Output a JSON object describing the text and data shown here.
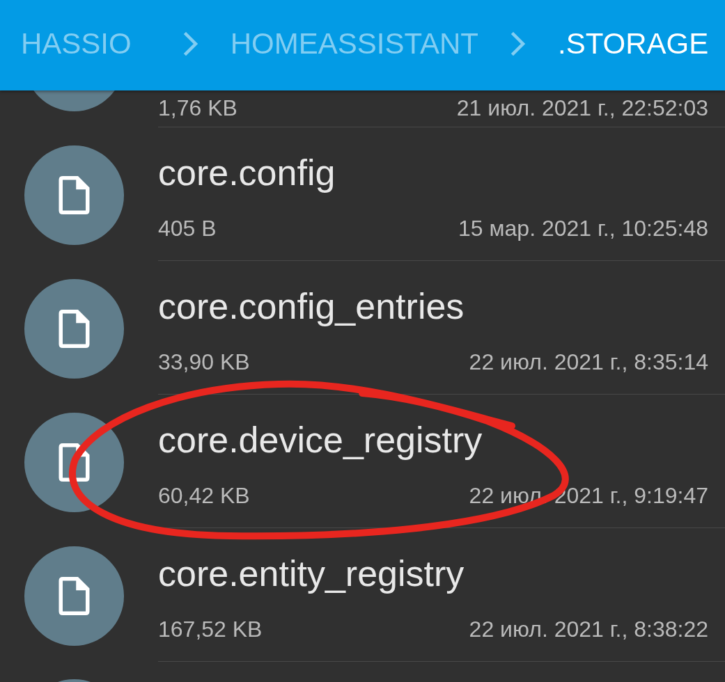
{
  "breadcrumbs": [
    {
      "label": "HASSIO",
      "selected": false
    },
    {
      "label": "HOMEASSISTANT",
      "selected": false
    },
    {
      "label": ".STORAGE",
      "selected": true
    }
  ],
  "files": [
    {
      "kind": "clipped_top",
      "size": "1,76 KB",
      "modified": "21 июл. 2021 г., 22:52:03",
      "circled": false
    },
    {
      "kind": "file",
      "name": "core.config",
      "size": "405 B",
      "modified": "15 мар. 2021 г., 10:25:48",
      "circled": false
    },
    {
      "kind": "file",
      "name": "core.config_entries",
      "size": "33,90 KB",
      "modified": "22 июл. 2021 г., 8:35:14",
      "circled": false
    },
    {
      "kind": "file",
      "name": "core.device_registry",
      "size": "60,42 KB",
      "modified": "22 июл. 2021 г., 9:19:47",
      "circled": true
    },
    {
      "kind": "file",
      "name": "core.entity_registry",
      "size": "167,52 KB",
      "modified": "22 июл. 2021 г., 8:38:22",
      "circled": false
    },
    {
      "kind": "clipped_bottom"
    }
  ]
}
